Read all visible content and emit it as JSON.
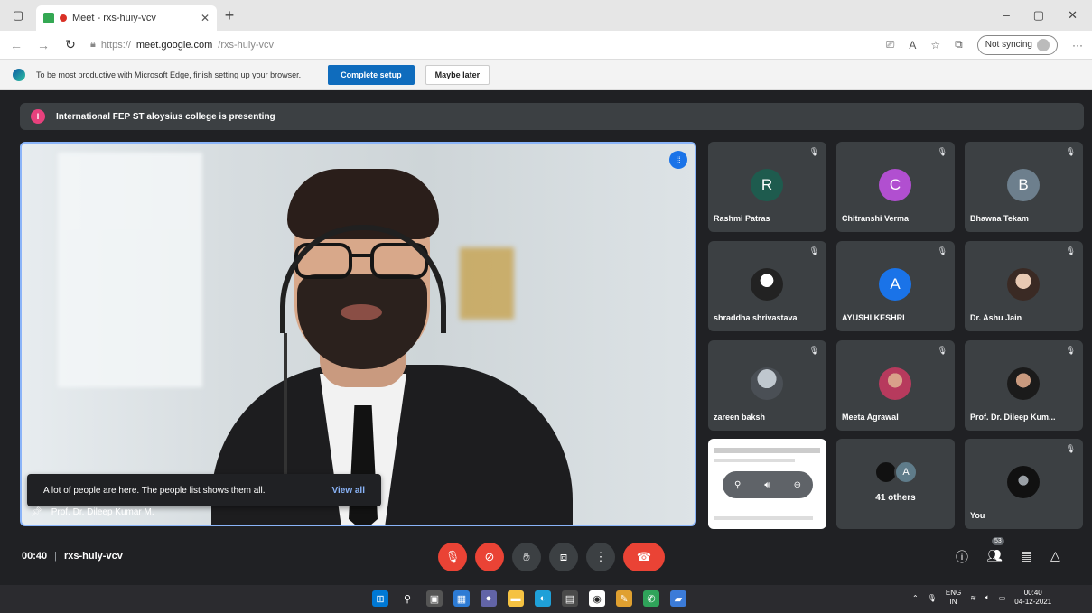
{
  "browser": {
    "tab_title": "Meet - rxs-huiy-vcv",
    "url_prefix": "https://",
    "url_host": "meet.google.com",
    "url_path": "/rxs-huiy-vcv",
    "sync_label": "Not syncing"
  },
  "infobar": {
    "message": "To be most productive with Microsoft Edge, finish setting up your browser.",
    "primary_button": "Complete setup",
    "secondary_button": "Maybe later"
  },
  "banner": {
    "text": "International FEP ST aloysius college is presenting"
  },
  "main_stage": {
    "presenter_name": "Prof. Dr. Dileep Kumar M.",
    "toast_text": "A lot of people are here. The people list shows them all.",
    "toast_link": "View all"
  },
  "participants": [
    {
      "name": "Rashmi Patras",
      "initial": "R",
      "color": "#1e5b4e",
      "kind": "initial"
    },
    {
      "name": "Chitranshi Verma",
      "initial": "C",
      "color": "#b14fd0",
      "kind": "initial"
    },
    {
      "name": "Bhawna Tekam",
      "initial": "B",
      "color": "#6d7f8d",
      "kind": "initial"
    },
    {
      "name": "shraddha shrivastava",
      "initial": "",
      "kind": "photo3"
    },
    {
      "name": "AYUSHI KESHRI",
      "initial": "A",
      "color": "#1a73e8",
      "kind": "initial"
    },
    {
      "name": "Dr. Ashu Jain",
      "initial": "",
      "kind": "photo"
    },
    {
      "name": "zareen baksh",
      "initial": "",
      "kind": "photo4"
    },
    {
      "name": "Meeta Agrawal",
      "initial": "",
      "kind": "photo5"
    },
    {
      "name": "Prof. Dr. Dileep Kum...",
      "initial": "",
      "kind": "photo2"
    }
  ],
  "others_tile": {
    "count_label": "41 others",
    "initial": "A"
  },
  "self_tile": {
    "name": "You"
  },
  "bottom_bar": {
    "time": "00:40",
    "separator": "|",
    "meeting_code": "rxs-huiy-vcv",
    "people_count": "53"
  },
  "taskbar": {
    "lang_top": "ENG",
    "lang_bottom": "IN",
    "clock_time": "00:40",
    "clock_date": "04-12-2021"
  }
}
